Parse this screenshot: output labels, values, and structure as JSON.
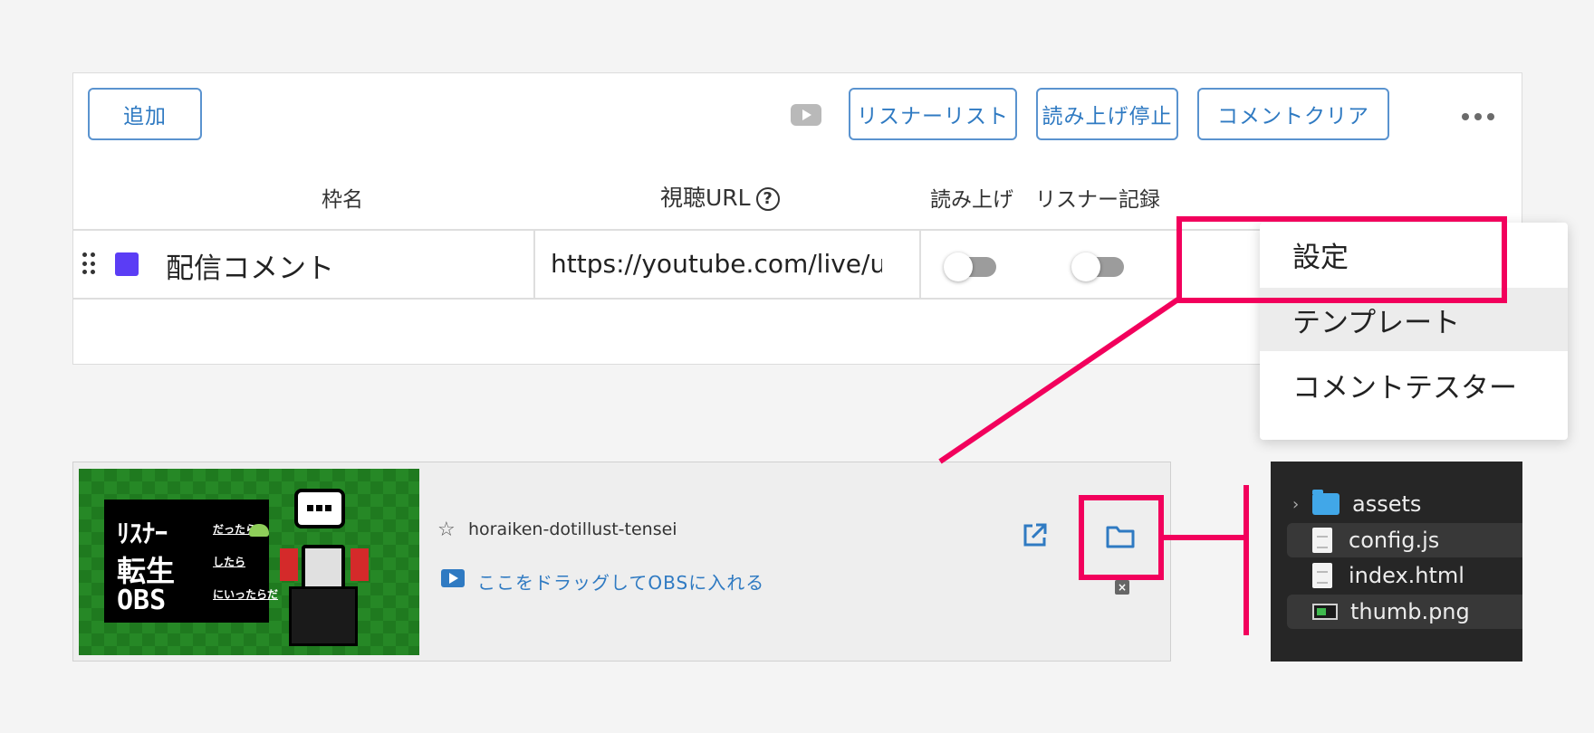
{
  "toolbar": {
    "add_label": "追加",
    "listener_list_label": "リスナーリスト",
    "stop_reading_label": "読み上げ停止",
    "clear_comments_label": "コメントクリア"
  },
  "table": {
    "headers": {
      "frame_name": "枠名",
      "view_url": "視聴URL",
      "read_aloud": "読み上げ",
      "listener_record": "リスナー記録"
    },
    "row": {
      "color": "#5b3df5",
      "name": "配信コメント",
      "url": "https://youtube.com/live/u"
    }
  },
  "menu": {
    "items": [
      "設定",
      "テンプレート",
      "コメントテスター"
    ]
  },
  "template_card": {
    "name": "horaiken-dotillust-tensei",
    "drag_hint": "ここをドラッグしてOBSに入れる",
    "thumbnail": {
      "line1": "ﾘｽﾅｰ",
      "line2": "転生",
      "line3": "OBS",
      "side1": "だったら",
      "side2": "したら",
      "side3": "にいったらだ"
    }
  },
  "explorer": {
    "items": [
      "assets",
      "config.js",
      "index.html",
      "thumb.png"
    ]
  },
  "colors": {
    "accent_blue": "#2f7ac2",
    "annotation_pink": "#f2005c"
  },
  "icons": {
    "drag_handle": "drag-handle-icon",
    "youtube": "youtube-icon",
    "more": "more-horizontal-icon",
    "help": "help-circle-icon",
    "star": "star-icon",
    "external_link": "external-link-icon",
    "folder": "folder-icon"
  }
}
